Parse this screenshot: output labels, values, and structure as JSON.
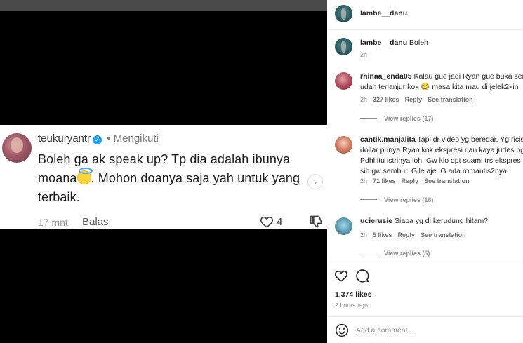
{
  "post": {
    "dots_active_color": "#ffffff",
    "dots_inactive_color": "#8a8a8a",
    "embedded_comment": {
      "username": "teukuryantr",
      "verified": true,
      "follow_status": "• Mengikuti",
      "text_before_emoji": "Boleh ga ak speak up? Tp dia adalah ibunya moana",
      "emoji": "smiling-face-with-halo",
      "text_after_emoji": ". Mohon doanya saja yah untuk yang terbaik.",
      "time": "17 mnt",
      "reply_label": "Balas",
      "likes": "4"
    }
  },
  "header": {
    "username": "lambe__danu"
  },
  "caption": {
    "username": "lambe__danu",
    "text": "Boleh",
    "time": "2h"
  },
  "comments": [
    {
      "username": "rhinaa_enda05",
      "lines": [
        "Kalau gue jadi Ryan gue buka sem",
        "udah terlanjur kok 😂 masa kita mau di jelek2kin"
      ],
      "first_line_inline": true,
      "time": "2h",
      "likes": "327 likes",
      "reply": "Reply",
      "translate": "See translation",
      "view_replies": "View replies (17)"
    },
    {
      "username": "cantik.manjalita",
      "lines": [
        "Tapi dr video yg beredar. Yg ricis",
        "dollar punya Ryan kok ekspresi rian kaya judes bg",
        "Pdhl itu istrinya loh. Gw klo dpt suami trs ekspres",
        "sih gw sembur. Gile aje. G ada romantis2nya"
      ],
      "first_line_inline": true,
      "time": "2h",
      "likes": "71 likes",
      "reply": "Reply",
      "translate": "See translation",
      "view_replies": "View replies (16)"
    },
    {
      "username": "ucierusie",
      "lines": [
        "Siapa yg di kerudung hitam?"
      ],
      "first_line_inline": true,
      "time": "2h",
      "likes": "5 likes",
      "reply": "Reply",
      "translate": "See translation",
      "view_replies": "View replies (5)"
    }
  ],
  "actions": {
    "icons": [
      "heart-icon",
      "comment-icon"
    ],
    "likes": "1,374 likes",
    "time_ago": "2 hours ago"
  },
  "composer": {
    "placeholder": "Add a comment…",
    "icon": "emoji-icon"
  }
}
